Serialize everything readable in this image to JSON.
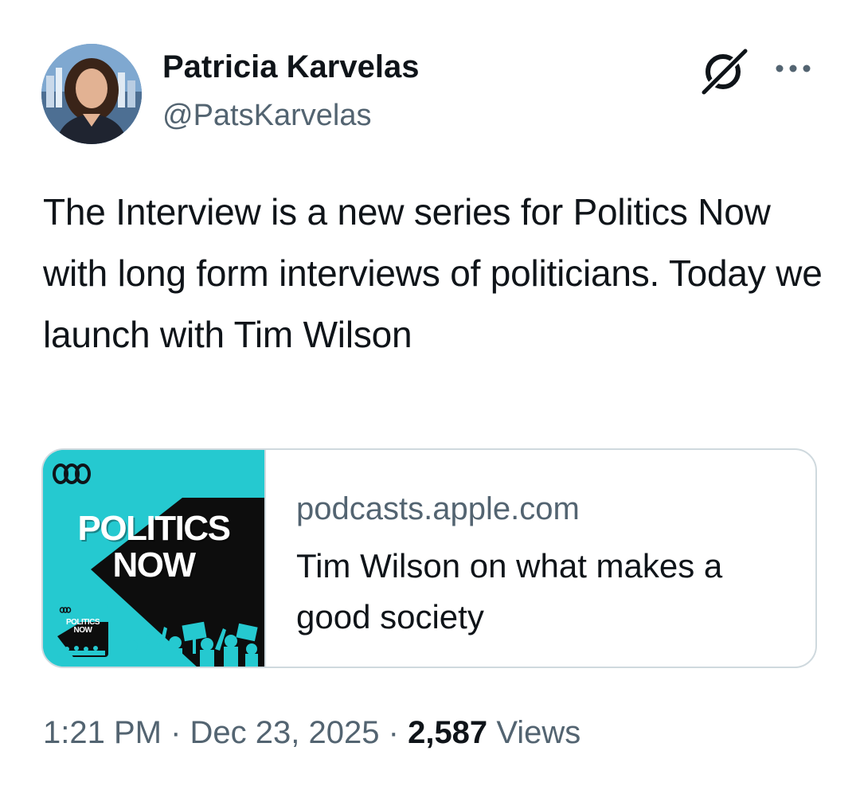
{
  "author": {
    "display_name": "Patricia Karvelas",
    "handle": "@PatsKarvelas"
  },
  "header_icons": {
    "grok": "grok-icon",
    "more": "more-icon"
  },
  "tweet": {
    "text": "The Interview is a new series for Politics Now with long form interviews of politicians. Today we launch with Tim Wilson"
  },
  "link_card": {
    "thumbnail": {
      "title_line1": "POLITICS",
      "title_line2": "NOW",
      "brand_logo": "abc-logo",
      "mini_title_line1": "POLITICS",
      "mini_title_line2": "NOW",
      "background_color": "#25c9d0"
    },
    "domain": "podcasts.apple.com",
    "title": "Tim Wilson on what makes a good society"
  },
  "meta": {
    "time": "1:21 PM",
    "separator": "·",
    "date": "Dec 23, 2025",
    "views_count": "2,587",
    "views_label": "Views"
  },
  "colors": {
    "text_primary": "#0f1419",
    "text_secondary": "#536471",
    "border": "#cfd9de",
    "thumb_accent": "#25c9d0"
  }
}
